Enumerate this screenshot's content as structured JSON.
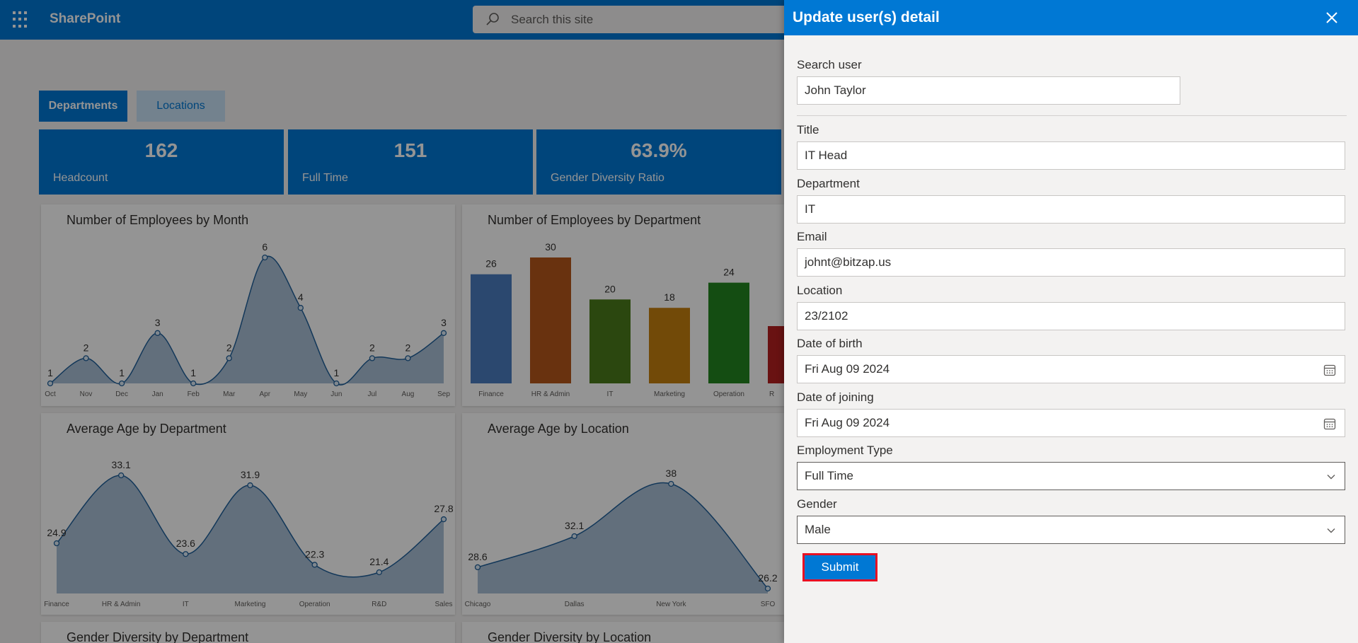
{
  "suite": {
    "brand": "SharePoint",
    "search_placeholder": "Search this site"
  },
  "tabs": [
    "Departments",
    "Locations"
  ],
  "kpis": [
    {
      "value": "162",
      "label": "Headcount"
    },
    {
      "value": "151",
      "label": "Full Time"
    },
    {
      "value": "63.9%",
      "label": "Gender Diversity Ratio"
    }
  ],
  "cards": {
    "c1": "Number of Employees by Month",
    "c2": "Number of Employees by Department",
    "c3": "Average Age by Department",
    "c4": "Average Age by Location",
    "c5": "Gender Diversity by Department",
    "c6": "Gender Diversity by Location"
  },
  "colors": {
    "accent": "#0078d4",
    "submit_border": "#e81123"
  },
  "chart_data": [
    {
      "type": "area",
      "title": "Number of Employees by Month",
      "categories": [
        "Oct",
        "Nov",
        "Dec",
        "Jan",
        "Feb",
        "Mar",
        "Apr",
        "May",
        "Jun",
        "Jul",
        "Aug",
        "Sep"
      ],
      "values": [
        1,
        2,
        1,
        3,
        1,
        2,
        6,
        4,
        1,
        2,
        2,
        3
      ],
      "ylim": [
        1,
        6
      ]
    },
    {
      "type": "bar",
      "title": "Number of Employees by Department",
      "categories": [
        "Finance",
        "HR & Admin",
        "IT",
        "Marketing",
        "Operation"
      ],
      "values": [
        26,
        30,
        20,
        18,
        24
      ],
      "colors": [
        "#4a7dbf",
        "#b5561a",
        "#4a7a1a",
        "#c5800e",
        "#23861f"
      ],
      "partial": {
        "label": "R",
        "color": "#b51f1f"
      },
      "ylim": [
        0,
        30
      ]
    },
    {
      "type": "area",
      "title": "Average Age by Department",
      "categories": [
        "Finance",
        "HR & Admin",
        "IT",
        "Marketing",
        "Operation",
        "R&D",
        "Sales"
      ],
      "values": [
        24.9,
        33.1,
        23.6,
        31.9,
        22.3,
        21.4,
        27.8
      ],
      "ylim": [
        21.4,
        33.1
      ]
    },
    {
      "type": "area",
      "title": "Average Age by Location",
      "categories": [
        "Chicago",
        "Dallas",
        "New York",
        "SFO"
      ],
      "values": [
        28.6,
        32.1,
        38,
        26.2
      ],
      "ylim": [
        26.2,
        38
      ]
    }
  ],
  "panel": {
    "title": "Update user(s) detail",
    "search_label": "Search user",
    "search_value": "John Taylor",
    "fields": [
      {
        "label": "Title",
        "value": "IT Head"
      },
      {
        "label": "Department",
        "value": "IT"
      },
      {
        "label": "Email",
        "value": "johnt@bitzap.us"
      },
      {
        "label": "Location",
        "value": "23/2102"
      },
      {
        "label": "Date of birth",
        "value": "Fri Aug 09 2024"
      },
      {
        "label": "Date of joining",
        "value": "Fri Aug 09 2024"
      },
      {
        "label": "Employment Type",
        "value": "Full Time"
      },
      {
        "label": "Gender",
        "value": "Male"
      }
    ],
    "submit": "Submit"
  }
}
